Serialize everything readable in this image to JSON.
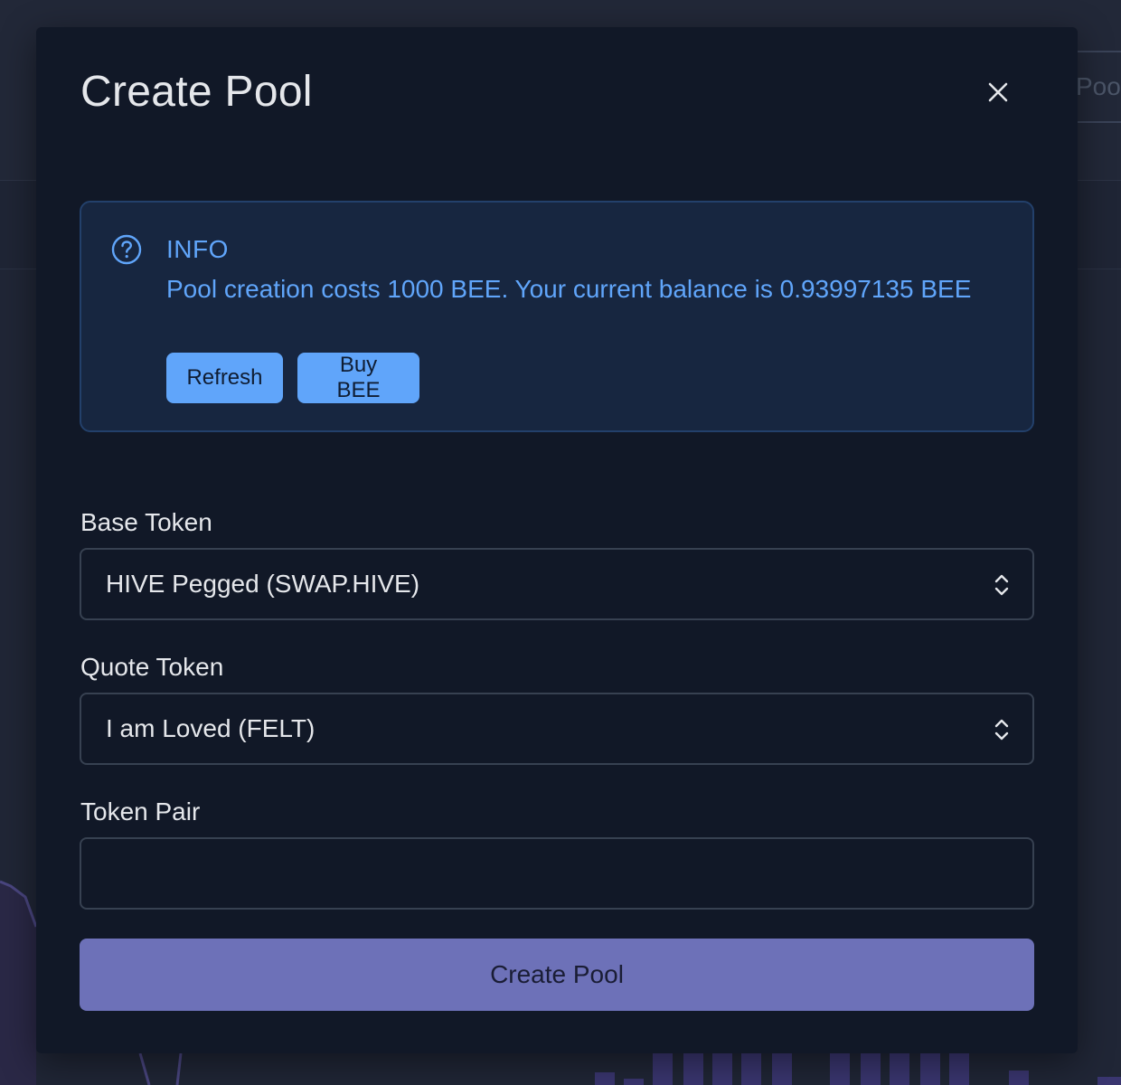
{
  "background": {
    "tab_label": "Poo"
  },
  "modal": {
    "title": "Create Pool",
    "close_icon": "close-icon",
    "info": {
      "icon": "question-circle-icon",
      "title": "INFO",
      "message": "Pool creation costs 1000 BEE. Your current balance is 0.93997135 BEE",
      "refresh_label": "Refresh",
      "buy_label": "Buy BEE"
    },
    "base_token": {
      "label": "Base Token",
      "selected": "HIVE Pegged (SWAP.HIVE)"
    },
    "quote_token": {
      "label": "Quote Token",
      "selected": "I am Loved (FELT)"
    },
    "token_pair": {
      "label": "Token Pair",
      "value": ""
    },
    "submit_label": "Create Pool"
  },
  "colors": {
    "accent_blue": "#60a5fa",
    "submit_purple": "#6d71b8",
    "modal_bg": "#111827"
  }
}
